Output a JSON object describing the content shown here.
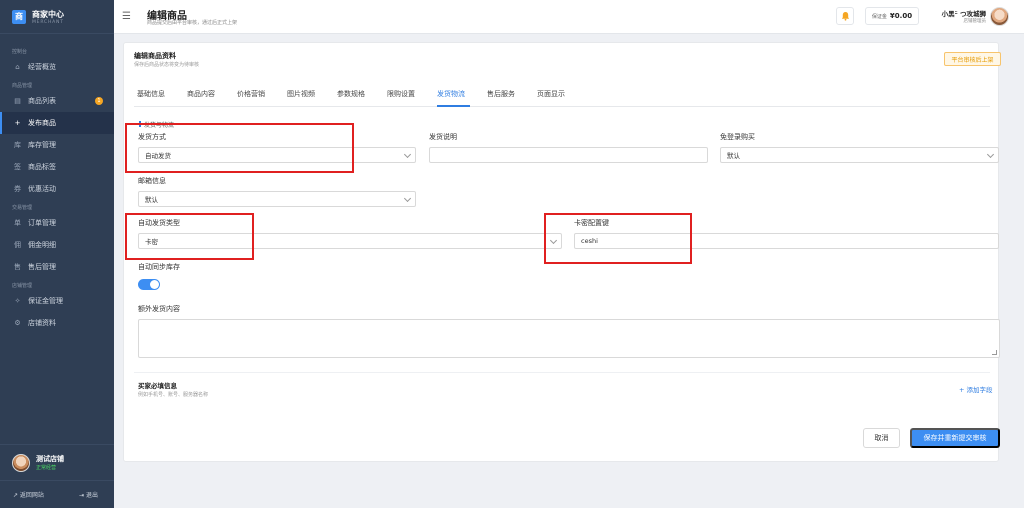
{
  "brand": {
    "logo": "商",
    "title": "商家中心",
    "subtitle": "MERCHANT"
  },
  "sidebar": {
    "groups": [
      {
        "label": "控制台",
        "items": [
          {
            "icon": "⌂",
            "label": "经营概览"
          }
        ]
      },
      {
        "label": "商品管理",
        "items": [
          {
            "icon": "▤",
            "label": "商品列表",
            "badge": "1"
          },
          {
            "icon": "+",
            "label": "发布商品",
            "active": true
          },
          {
            "icon": "库",
            "label": "库存管理"
          },
          {
            "icon": "签",
            "label": "商品标签"
          },
          {
            "icon": "券",
            "label": "优惠活动"
          }
        ]
      },
      {
        "label": "交易管理",
        "items": [
          {
            "icon": "单",
            "label": "订单管理"
          },
          {
            "icon": "佣",
            "label": "佣金明细"
          },
          {
            "icon": "售",
            "label": "售后管理"
          }
        ]
      },
      {
        "label": "店铺管理",
        "items": [
          {
            "icon": "✧",
            "label": "保证金管理"
          },
          {
            "icon": "⚙",
            "label": "店铺资料"
          }
        ]
      }
    ],
    "shop": {
      "name": "测试店铺",
      "status": "正常经营"
    },
    "footer": {
      "back": "↗ 返回网站",
      "logout": "⇥ 退出"
    }
  },
  "header": {
    "title": "编辑商品",
    "subtitle": "商品提交后由平台审核，通过后正式上架",
    "bond_label": "保证金",
    "bond_value": "¥0.00",
    "user_name": "小黑ᵕ̈ つ攻城狮",
    "user_role": "店铺管理员"
  },
  "card": {
    "title": "编辑商品资料",
    "subtitle": "保存后商品状态将变为待审核",
    "review_tag": "平台审核后上架"
  },
  "tabs": [
    "基础信息",
    "商品内容",
    "价格营销",
    "图片视频",
    "参数规格",
    "限购设置",
    "发货物流",
    "售后服务",
    "页面显示"
  ],
  "form": {
    "section_title": "发货与物流",
    "ship_method_label": "发货方式",
    "ship_method_value": "自动发货",
    "ship_note_label": "发货说明",
    "ship_note_value": "",
    "login_free_label": "免登录购买",
    "login_free_value": "默认",
    "postage_label": "邮箱信息",
    "postage_value": "默认",
    "auto_type_label": "自动发货类型",
    "auto_type_value": "卡密",
    "card_key_label": "卡密配置键",
    "card_key_value": "ceshi",
    "sync_stock_label": "自动同步库存",
    "sync_stock_on": true,
    "extra_label": "额外发货内容",
    "buyer_info_title": "买家必填信息",
    "buyer_info_sub": "例如手机号、账号、服务器名称",
    "add_field": "+ 添加字段"
  },
  "actions": {
    "cancel": "取消",
    "submit": "保存并重新提交审核"
  },
  "colors": {
    "accent": "#3d8ef2",
    "sidebar": "#2f3e54",
    "highlight": "#e02020",
    "warning": "#f5a623"
  }
}
